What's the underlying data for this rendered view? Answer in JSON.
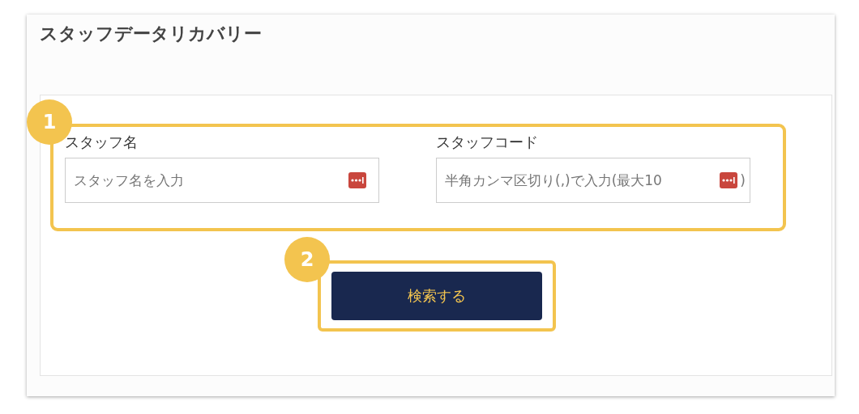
{
  "title": "スタッフデータリカバリー",
  "fields": [
    {
      "label": "スタッフ名",
      "placeholder": "スタッフ名を入力"
    },
    {
      "label": "スタッフコード",
      "placeholder": "半角カンマ区切り(,)で入力(最大10",
      "placeholder_tail": ")"
    }
  ],
  "search_button": "検索する",
  "callouts": [
    {
      "number": "1"
    },
    {
      "number": "2"
    }
  ]
}
